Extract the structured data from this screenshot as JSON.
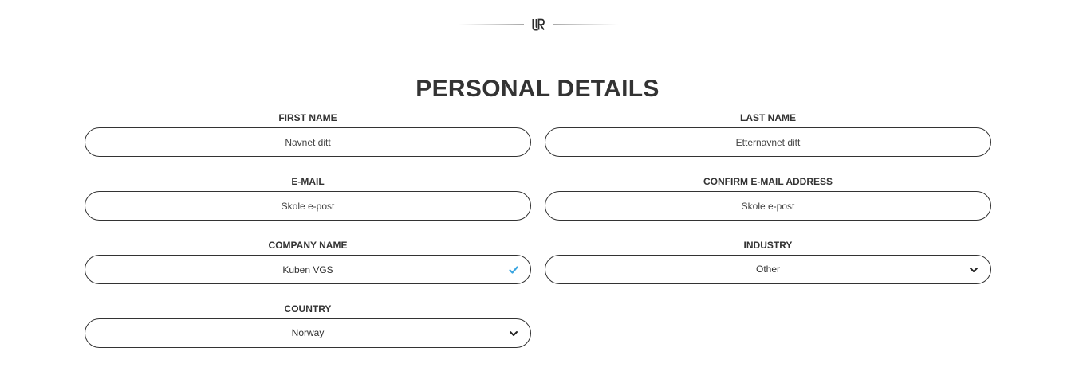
{
  "logo": {
    "icon": "ur-logo-icon"
  },
  "title": "PERSONAL DETAILS",
  "fields": {
    "first_name": {
      "label": "FIRST NAME",
      "placeholder": "Navnet ditt",
      "value": ""
    },
    "last_name": {
      "label": "LAST NAME",
      "placeholder": "Etternavnet ditt",
      "value": ""
    },
    "email": {
      "label": "E-MAIL",
      "placeholder": "Skole e-post",
      "value": ""
    },
    "confirm_email": {
      "label": "CONFIRM E-MAIL ADDRESS",
      "placeholder": "Skole e-post",
      "value": ""
    },
    "company": {
      "label": "COMPANY NAME",
      "value": "Kuben VGS",
      "status_icon": "checkmark-icon"
    },
    "industry": {
      "label": "INDUSTRY",
      "selected": "Other",
      "icon": "chevron-down-icon"
    },
    "country": {
      "label": "COUNTRY",
      "selected": "Norway",
      "icon": "chevron-down-icon"
    }
  },
  "colors": {
    "text": "#333333",
    "border": "#333333",
    "check": "#3aa5e0"
  }
}
